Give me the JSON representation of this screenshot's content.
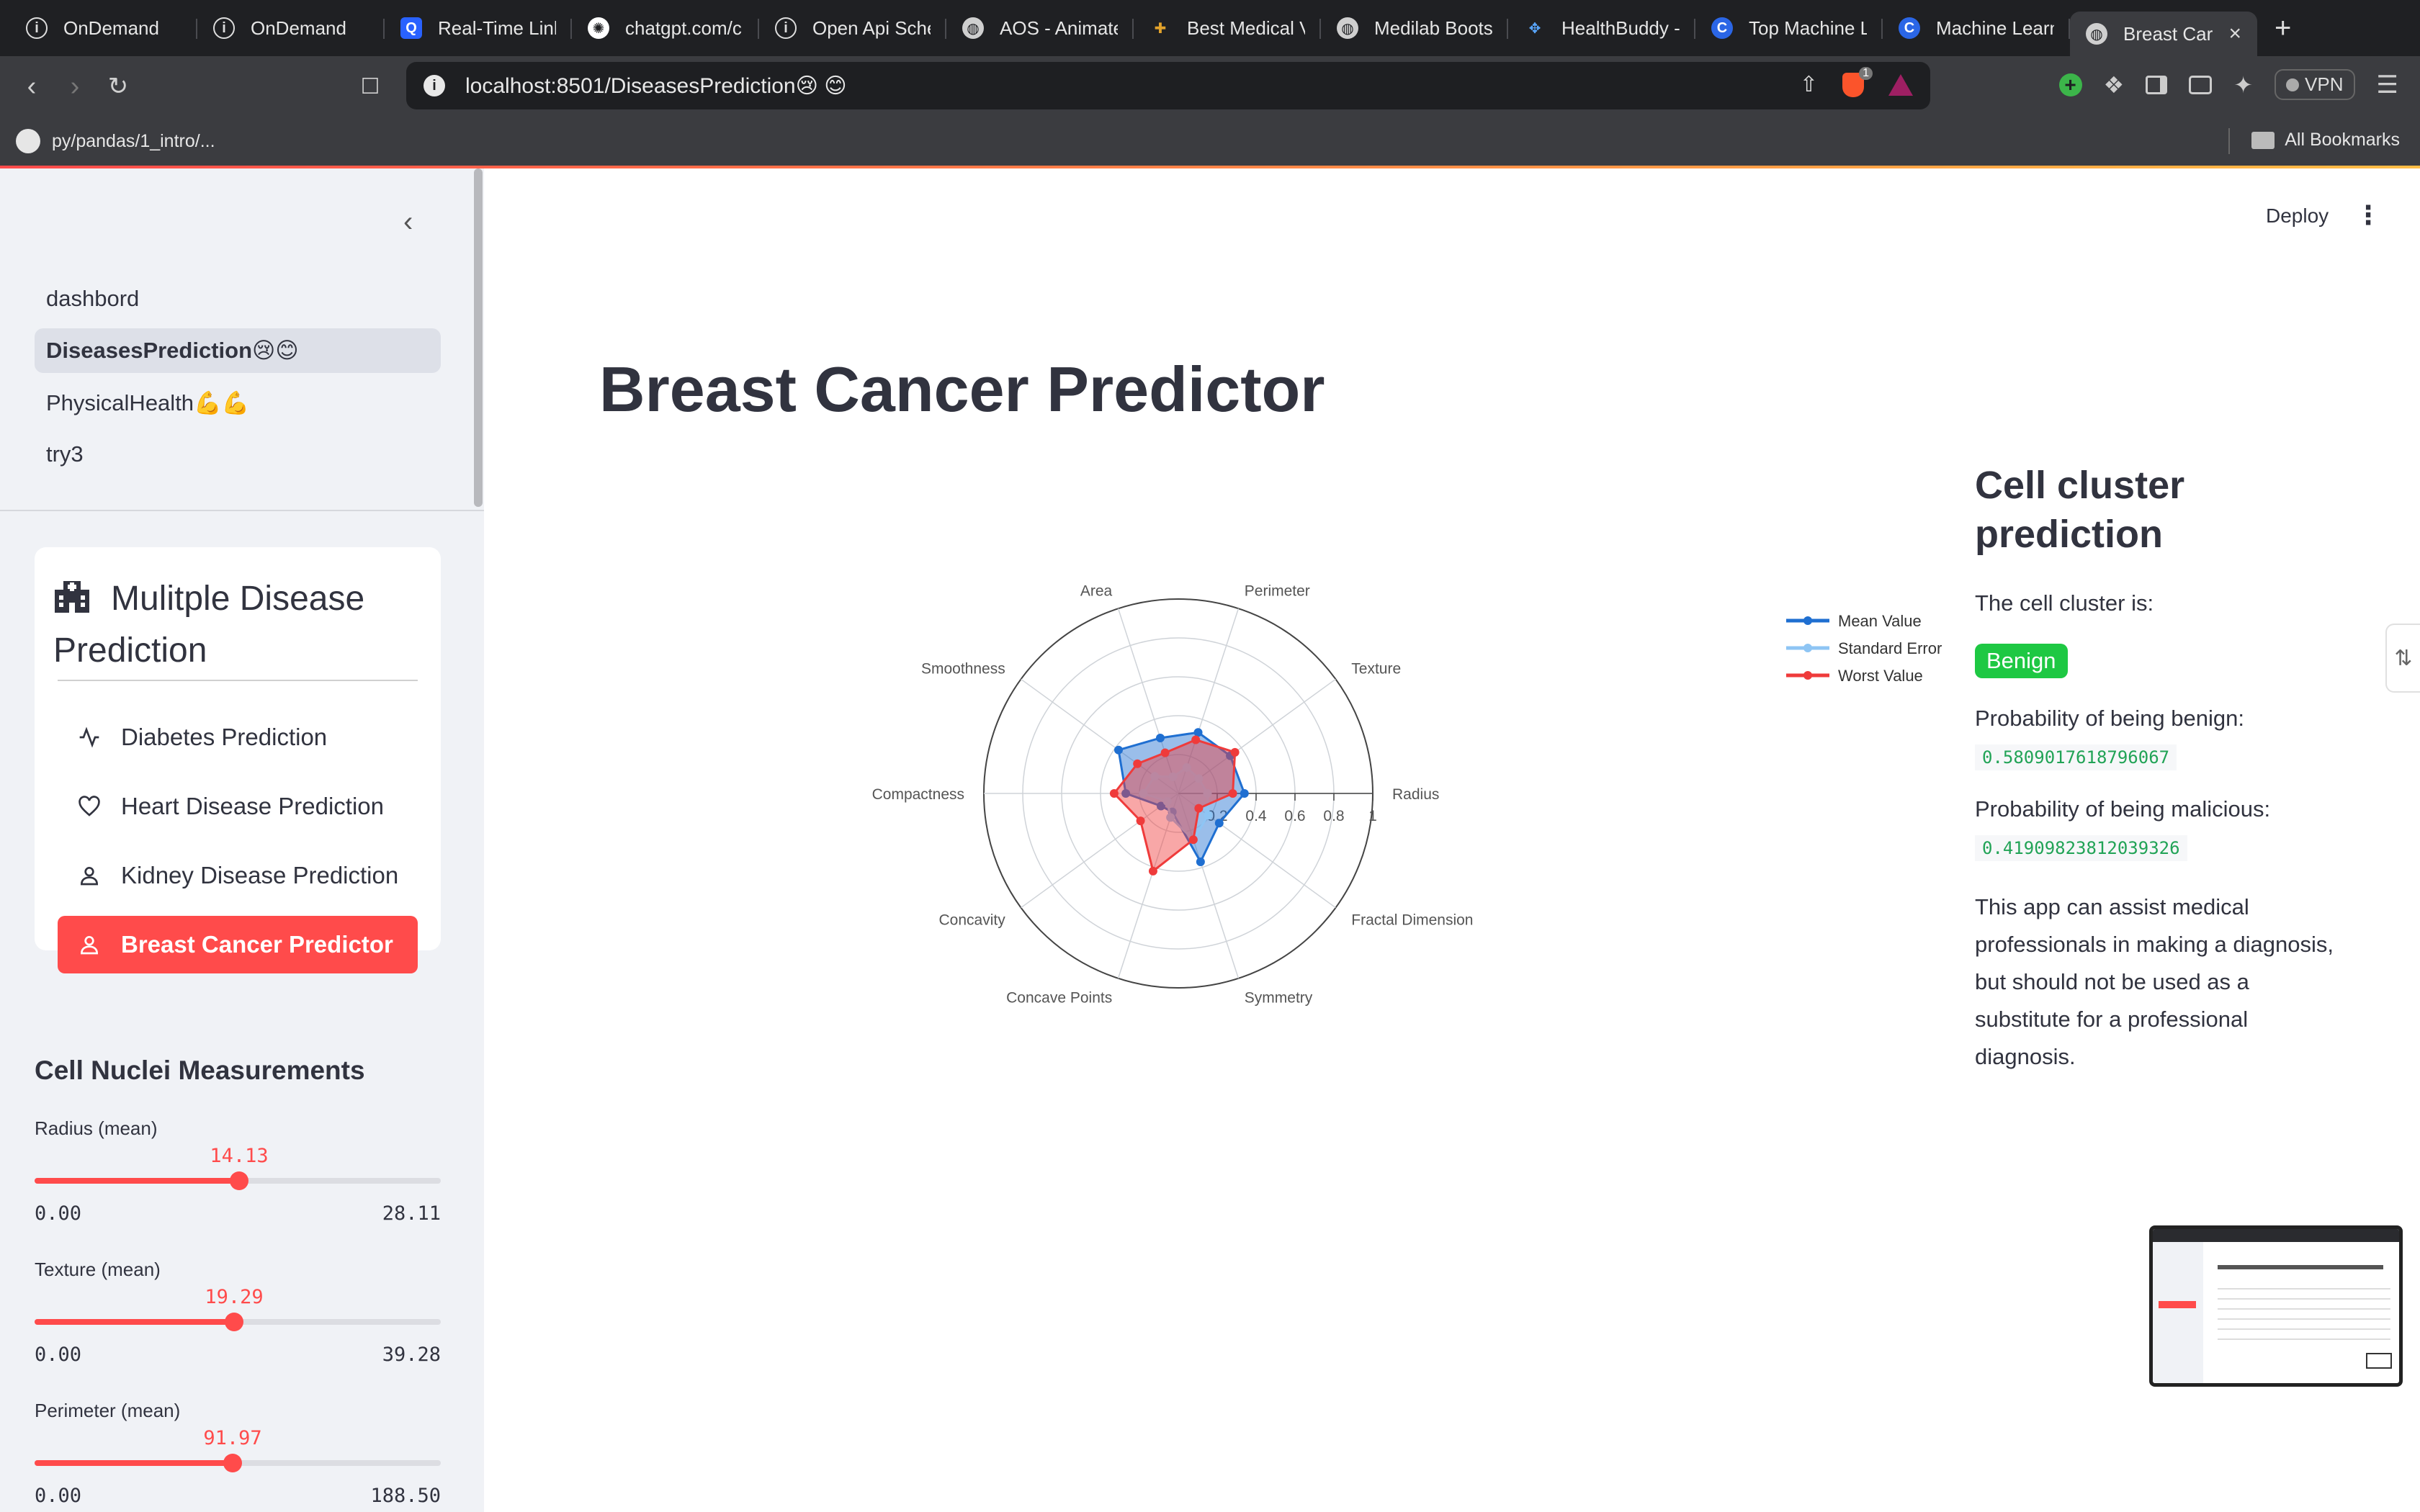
{
  "browser": {
    "tabs": [
      {
        "title": "OnDemand",
        "icon": "info-icon",
        "active": false
      },
      {
        "title": "OnDemand",
        "icon": "info-icon",
        "active": false
      },
      {
        "title": "Real-Time Link",
        "icon": "q-logo-icon",
        "active": false
      },
      {
        "title": "chatgpt.com/c",
        "icon": "chatgpt-icon",
        "active": false
      },
      {
        "title": "Open Api Sche",
        "icon": "info-icon",
        "active": false
      },
      {
        "title": "AOS - Animate",
        "icon": "globe-icon",
        "active": false
      },
      {
        "title": "Best Medical V",
        "icon": "medical-icon",
        "active": false
      },
      {
        "title": "Medilab Boots",
        "icon": "globe-icon",
        "active": false
      },
      {
        "title": "HealthBuddy -",
        "icon": "healthbuddy-icon",
        "active": false
      },
      {
        "title": "Top Machine L",
        "icon": "c-logo-icon",
        "active": false
      },
      {
        "title": "Machine Learn",
        "icon": "c-logo-icon",
        "active": false
      },
      {
        "title": "Breast Car",
        "icon": "globe-icon",
        "active": true
      }
    ],
    "url": "localhost:8501/DiseasesPrediction😢 😊",
    "vpn_label": "VPN",
    "bookmark": "py/pandas/1_intro/...",
    "all_bookmarks": "All Bookmarks",
    "badge_count": "1"
  },
  "sidebar": {
    "pages": [
      {
        "label": "dashbord",
        "active": false
      },
      {
        "label": "DiseasesPrediction😢😊",
        "active": true
      },
      {
        "label": "PhysicalHealth💪💪",
        "active": false
      },
      {
        "label": "try3",
        "active": false
      }
    ],
    "menu": {
      "title": "Mulitple Disease Prediction",
      "items": [
        {
          "label": "Diabetes Prediction",
          "icon": "activity-icon",
          "active": false
        },
        {
          "label": "Heart Disease Prediction",
          "icon": "heart-icon",
          "active": false
        },
        {
          "label": "Kidney Disease Prediction",
          "icon": "person-icon",
          "active": false
        },
        {
          "label": "Breast Cancer Predictor",
          "icon": "person-icon",
          "active": true
        }
      ]
    },
    "measurements_title": "Cell Nuclei Measurements",
    "sliders": [
      {
        "label": "Radius (mean)",
        "value": "14.13",
        "min": "0.00",
        "max": "28.11",
        "fraction": 0.5027
      },
      {
        "label": "Texture (mean)",
        "value": "19.29",
        "min": "0.00",
        "max": "39.28",
        "fraction": 0.4911
      },
      {
        "label": "Perimeter (mean)",
        "value": "91.97",
        "min": "0.00",
        "max": "188.50",
        "fraction": 0.4879
      }
    ]
  },
  "header": {
    "deploy": "Deploy"
  },
  "main": {
    "title": "Breast Cancer Predictor"
  },
  "prediction": {
    "heading": "Cell cluster prediction",
    "cluster_text": "The cell cluster is:",
    "result": "Benign",
    "benign_label": "Probability of being benign:",
    "benign_value": "0.5809017618796067",
    "malicious_label": "Probability of being malicious:",
    "malicious_value": "0.41909823812039326",
    "disclaimer": "This app can assist medical professionals in making a diagnosis, but should not be used as a substitute for a professional diagnosis."
  },
  "colors": {
    "accent": "#ff4b4b",
    "benign": "#1ec843",
    "mean_series": "#1f6fd1",
    "se_series": "#8ec5f4",
    "worst_series": "#ef3b3b"
  },
  "chart_data": {
    "type": "radar",
    "categories": [
      "Radius",
      "Texture",
      "Perimeter",
      "Area",
      "Smoothness",
      "Compactness",
      "Concavity",
      "Concave Points",
      "Symmetry",
      "Fractal Dimension"
    ],
    "radial_ticks": [
      "0.2",
      "0.4",
      "0.6",
      "0.8",
      "1"
    ],
    "radial_range": [
      0,
      1
    ],
    "grid": true,
    "legend_position": "right",
    "series": [
      {
        "name": "Mean Value",
        "values": [
          0.34,
          0.33,
          0.33,
          0.3,
          0.38,
          0.27,
          0.11,
          0.1,
          0.37,
          0.26
        ]
      },
      {
        "name": "Standard Error",
        "values": [
          0.15,
          0.13,
          0.14,
          0.09,
          0.15,
          0.18,
          0.07,
          0.13,
          0.25,
          0.19
        ]
      },
      {
        "name": "Worst Value",
        "values": [
          0.28,
          0.36,
          0.29,
          0.22,
          0.26,
          0.33,
          0.24,
          0.42,
          0.25,
          0.13
        ]
      }
    ]
  }
}
